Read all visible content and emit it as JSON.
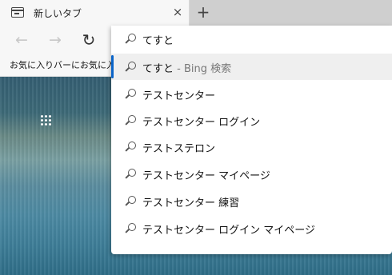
{
  "tab": {
    "title": "新しいタブ",
    "close_glyph": "×",
    "icon": "newtab-page-icon"
  },
  "newtab_glyph": "+",
  "toolbar": {
    "back_glyph": "←",
    "forward_glyph": "→",
    "reload_glyph": "↻"
  },
  "favorites": {
    "text": "お気に入りバーにお気に入り"
  },
  "omnibox": {
    "query": "てすと",
    "accent_color": "#0a64c8",
    "suggestions": [
      {
        "text": "てすと",
        "extra": " - Bing 検索",
        "selected": true
      },
      {
        "text": "テストセンター",
        "extra": ""
      },
      {
        "text": "テストセンター ログイン",
        "extra": ""
      },
      {
        "text": "テストステロン",
        "extra": ""
      },
      {
        "text": "テストセンター マイページ",
        "extra": ""
      },
      {
        "text": "テストセンター 練習",
        "extra": ""
      },
      {
        "text": "テストセンター ログイン マイページ",
        "extra": ""
      }
    ]
  }
}
